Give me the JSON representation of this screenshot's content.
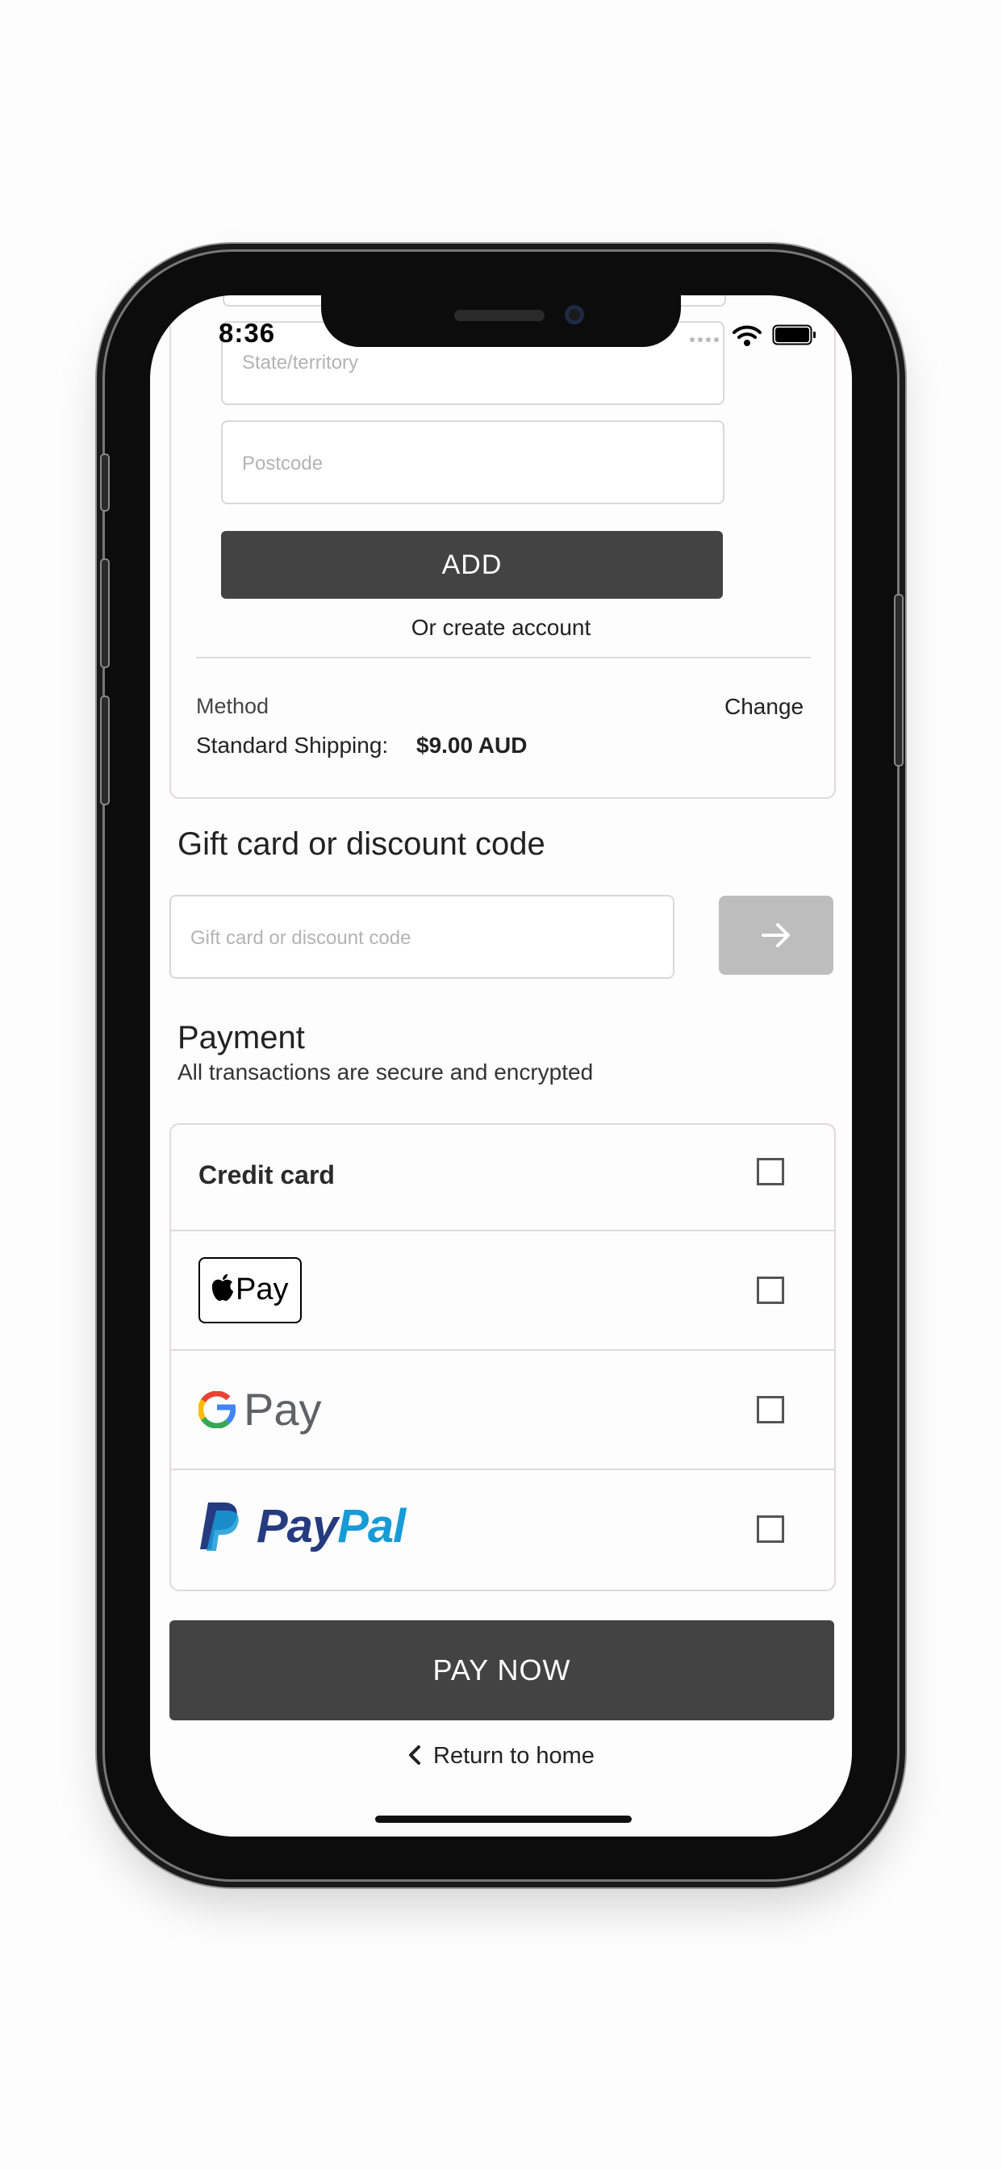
{
  "status_bar": {
    "time": "8:36"
  },
  "address": {
    "state_placeholder": "State/territory",
    "postcode_placeholder": "Postcode",
    "add_label": "ADD",
    "create_account_label": "Or create account"
  },
  "shipping": {
    "method_label": "Method",
    "change_label": "Change",
    "name": "Standard Shipping:",
    "price": "$9.00 AUD"
  },
  "discount": {
    "heading": "Gift card or discount code",
    "placeholder": "Gift card or discount code",
    "submit_icon": "arrow-right-icon"
  },
  "payment": {
    "heading": "Payment",
    "subheading": "All transactions are secure and encrypted",
    "options": [
      {
        "label": "Credit card"
      },
      {
        "label": "Pay",
        "icon": "apple-pay-logo"
      },
      {
        "label": "Pay",
        "icon": "google-pay-logo"
      },
      {
        "label": "PayPal",
        "icon": "paypal-logo"
      }
    ]
  },
  "actions": {
    "pay_now_label": "PAY NOW",
    "return_label": "Return to home"
  },
  "colors": {
    "dark_button": "#434343",
    "disabled_button": "#bdbdbd",
    "paypal_dark": "#253b80",
    "paypal_light": "#179bd7"
  }
}
